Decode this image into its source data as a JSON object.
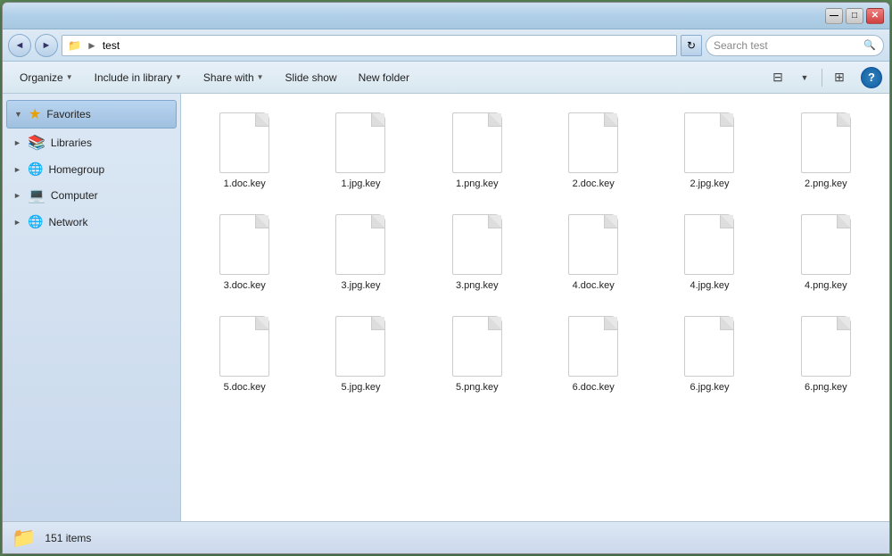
{
  "window": {
    "title": "test",
    "min_btn": "—",
    "max_btn": "□",
    "close_btn": "✕"
  },
  "address_bar": {
    "back_arrow": "◄",
    "forward_arrow": "►",
    "folder_icon": "📁",
    "path_text": "test",
    "path_arrow": "►",
    "refresh_icon": "↻",
    "search_placeholder": "Search test",
    "search_icon": "🔍"
  },
  "toolbar": {
    "organize_label": "Organize",
    "include_in_library_label": "Include in library",
    "share_with_label": "Share with",
    "slide_show_label": "Slide show",
    "new_folder_label": "New folder",
    "view_icon1": "⊟",
    "view_icon2": "⊞",
    "help_label": "?"
  },
  "sidebar": {
    "items": [
      {
        "id": "favorites",
        "label": "Favorites",
        "icon": "★",
        "selected": true,
        "expand": "▼"
      },
      {
        "id": "libraries",
        "label": "Libraries",
        "icon": "📚",
        "selected": false,
        "expand": "►"
      },
      {
        "id": "homegroup",
        "label": "Homegroup",
        "icon": "🌐",
        "selected": false,
        "expand": "►"
      },
      {
        "id": "computer",
        "label": "Computer",
        "icon": "💻",
        "selected": false,
        "expand": "►"
      },
      {
        "id": "network",
        "label": "Network",
        "icon": "🌐",
        "selected": false,
        "expand": "►"
      }
    ]
  },
  "files": [
    {
      "name": "1.doc.key"
    },
    {
      "name": "1.jpg.key"
    },
    {
      "name": "1.png.key"
    },
    {
      "name": "2.doc.key"
    },
    {
      "name": "2.jpg.key"
    },
    {
      "name": "2.png.key"
    },
    {
      "name": "3.doc.key"
    },
    {
      "name": "3.jpg.key"
    },
    {
      "name": "3.png.key"
    },
    {
      "name": "4.doc.key"
    },
    {
      "name": "4.jpg.key"
    },
    {
      "name": "4.png.key"
    },
    {
      "name": "5.doc.key"
    },
    {
      "name": "5.jpg.key"
    },
    {
      "name": "5.png.key"
    },
    {
      "name": "6.doc.key"
    },
    {
      "name": "6.jpg.key"
    },
    {
      "name": "6.png.key"
    }
  ],
  "status": {
    "folder_icon": "📁",
    "item_count": "151 items"
  }
}
